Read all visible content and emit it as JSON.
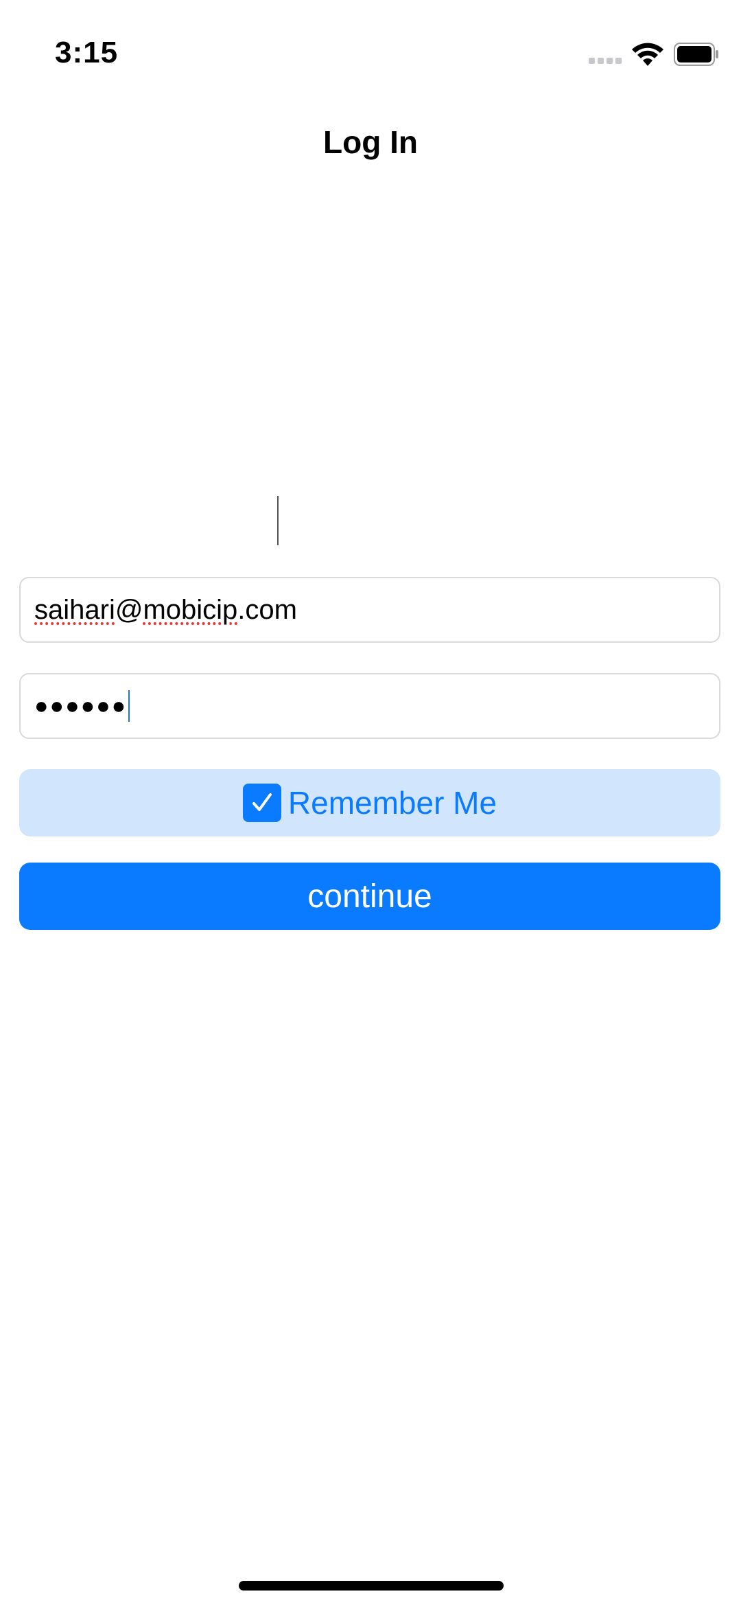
{
  "status_bar": {
    "time": "3:15",
    "signal_icon": "cellular-signal-icon",
    "wifi_icon": "wifi-icon",
    "battery_icon": "battery-full-icon"
  },
  "header": {
    "title": "Log In"
  },
  "form": {
    "email": {
      "part1": "saihari",
      "part2": "@",
      "part3": "mobicip",
      "part4": ".com"
    },
    "password": {
      "masked_value": "●●●●●●"
    },
    "remember_me": {
      "label": "Remember Me",
      "checked": true,
      "icon": "checkmark-icon"
    },
    "continue_label": "continue"
  },
  "colors": {
    "accent": "#0a7aff",
    "remember_bg": "#d1e6fd",
    "spellcheck": "#e53935"
  }
}
